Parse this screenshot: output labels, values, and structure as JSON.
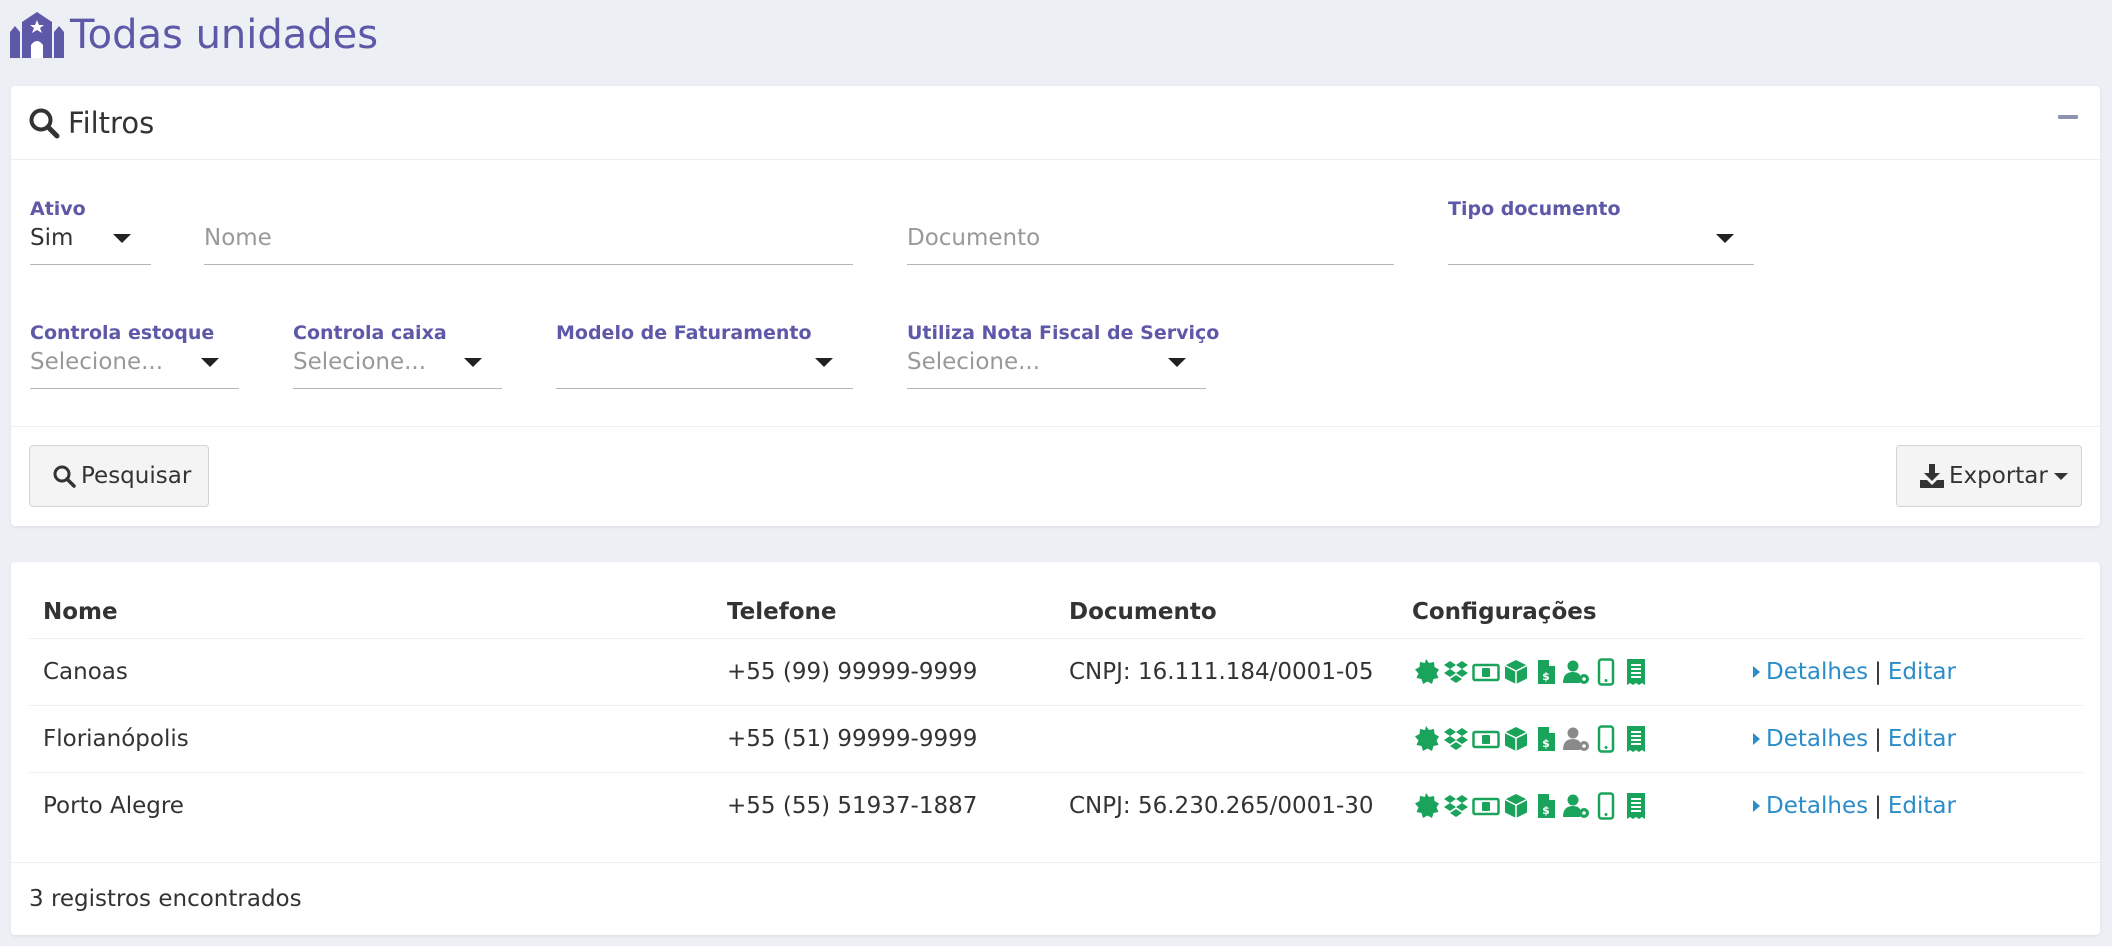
{
  "header": {
    "title": "Todas unidades",
    "icon": "building-icon"
  },
  "filters": {
    "title": "Filtros",
    "ativo": {
      "label": "Ativo",
      "value": "Sim"
    },
    "nome": {
      "placeholder": "Nome"
    },
    "documento": {
      "placeholder": "Documento"
    },
    "tipo_documento": {
      "label": "Tipo documento",
      "value": ""
    },
    "controla_estoque": {
      "label": "Controla estoque",
      "placeholder": "Selecione..."
    },
    "controla_caixa": {
      "label": "Controla caixa",
      "placeholder": "Selecione..."
    },
    "modelo_faturamento": {
      "label": "Modelo de Faturamento",
      "value": ""
    },
    "nota_fiscal": {
      "label": "Utiliza Nota Fiscal de Serviço",
      "placeholder": "Selecione..."
    },
    "search_label": "Pesquisar",
    "export_label": "Exportar"
  },
  "table": {
    "columns": [
      "Nome",
      "Telefone",
      "Documento",
      "Configurações"
    ],
    "rows": [
      {
        "nome": "Canoas",
        "telefone": "+55 (99) 99999-9999",
        "documento": "CNPJ: 16.111.184/0001-05",
        "user_config_active": true
      },
      {
        "nome": "Florianópolis",
        "telefone": "+55 (51) 99999-9999",
        "documento": "",
        "user_config_active": false
      },
      {
        "nome": "Porto Alegre",
        "telefone": "+55 (55) 51937-1887",
        "documento": "CNPJ: 56.230.265/0001-30",
        "user_config_active": true
      }
    ],
    "action_details": "Detalhes",
    "action_edit": "Editar",
    "action_separator": "|"
  },
  "footer": {
    "count_text": "3 registros encontrados"
  },
  "colors": {
    "accent": "#5e58a8",
    "green": "#1aa35a",
    "link": "#2a8cc8",
    "inactive": "#8a8a8a",
    "background": "#eceff4"
  },
  "config_icons": [
    "badge-icon",
    "dropbox-icon",
    "money-bill-icon",
    "box-icon",
    "file-invoice-dollar-icon",
    "user-cog-icon",
    "mobile-icon",
    "receipt-icon"
  ]
}
